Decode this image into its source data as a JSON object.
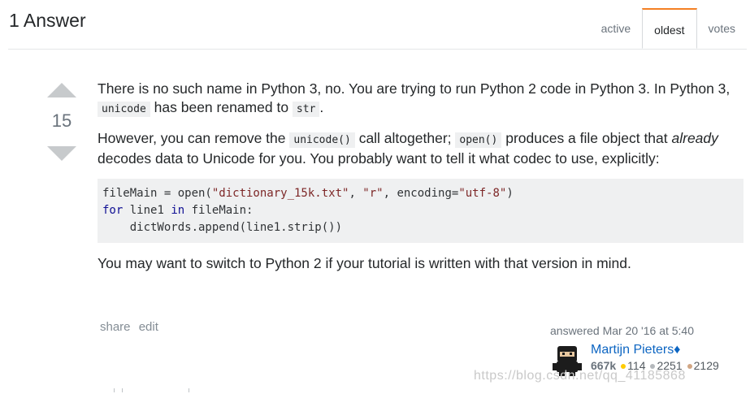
{
  "header": {
    "title": "1 Answer",
    "tabs": [
      "active",
      "oldest",
      "votes"
    ]
  },
  "answer": {
    "vote_count": "15",
    "p1_a": "There is no such name in Python 3, no. You are trying to run Python 2 code in Python 3. In Python 3, ",
    "p1_code1": "unicode",
    "p1_b": " has been renamed to ",
    "p1_code2": "str",
    "p1_c": ".",
    "p2_a": "However, you can remove the ",
    "p2_code1": "unicode()",
    "p2_b": " call altogether; ",
    "p2_code2": "open()",
    "p2_c": " produces a file object that ",
    "p2_em": "already",
    "p2_d": " decodes data to Unicode for you. You probably want to tell it what codec to use, explicitly:",
    "code": {
      "l1_a": "fileMain = open(",
      "l1_s1": "\"dictionary_15k.txt\"",
      "l1_b": ", ",
      "l1_s2": "\"r\"",
      "l1_c": ", encoding=",
      "l1_s3": "\"utf-8\"",
      "l1_d": ")",
      "l2_kw1": "for",
      "l2_a": " line1 ",
      "l2_kw2": "in",
      "l2_b": " fileMain:",
      "l3": "    dictWords.append(line1.strip())"
    },
    "p3": "You may want to switch to Python 2 if your tutorial is written with that version in mind.",
    "menu": {
      "share": "share",
      "edit": "edit"
    },
    "signature": {
      "action": "answered Mar 20 '16 at 5:40",
      "user_name": "Martijn Pieters",
      "moderator_glyph": "♦",
      "reputation": "667k",
      "gold": "114",
      "silver": "2251",
      "bronze": "2129"
    }
  },
  "watermark": "https://blog.csdn.net/qq_41185868"
}
